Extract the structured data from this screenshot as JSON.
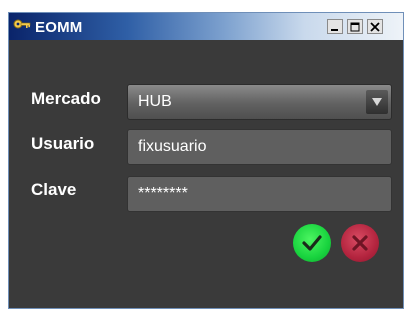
{
  "window": {
    "title": "EOMM",
    "icon": "key-icon",
    "controls": {
      "minimize": "minimize-icon",
      "maximize": "maximize-icon",
      "close": "close-icon"
    }
  },
  "form": {
    "market": {
      "label": "Mercado",
      "value": "HUB"
    },
    "user": {
      "label": "Usuario",
      "value": "fixusuario"
    },
    "password": {
      "label": "Clave",
      "value": "********"
    }
  },
  "actions": {
    "ok": {
      "icon": "check-icon",
      "color": "#1fd944"
    },
    "cancel": {
      "icon": "x-icon",
      "color": "#b3243e"
    }
  }
}
